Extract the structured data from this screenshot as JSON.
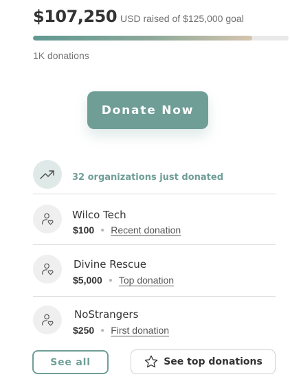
{
  "fundraiser": {
    "raised_amount": "$107,250",
    "goal_text": "USD raised of $125,000 goal",
    "progress_fraction": 0.858,
    "donations_count": "1K donations",
    "donate_label": "Donate Now"
  },
  "activity": {
    "icon": "trending-up-icon",
    "text": "32 organizations just donated"
  },
  "donors": [
    {
      "name": "Wilco Tech",
      "amount": "$100",
      "tag": "Recent donation",
      "icon": "donor-heart-icon"
    },
    {
      "name": "Divine Rescue",
      "amount": "$5,000",
      "tag": "Top donation",
      "icon": "donor-heart-icon"
    },
    {
      "name": "NoStrangers",
      "amount": "$250",
      "tag": "First donation",
      "icon": "donor-heart-icon"
    }
  ],
  "actions": {
    "see_all": "See all",
    "see_top": "See top donations",
    "see_top_icon": "star-icon"
  },
  "colors": {
    "accent": "#6f9e97",
    "progress_start": "#5f9891",
    "progress_end": "#d5c5ad",
    "divider": "#d8d8d8"
  }
}
